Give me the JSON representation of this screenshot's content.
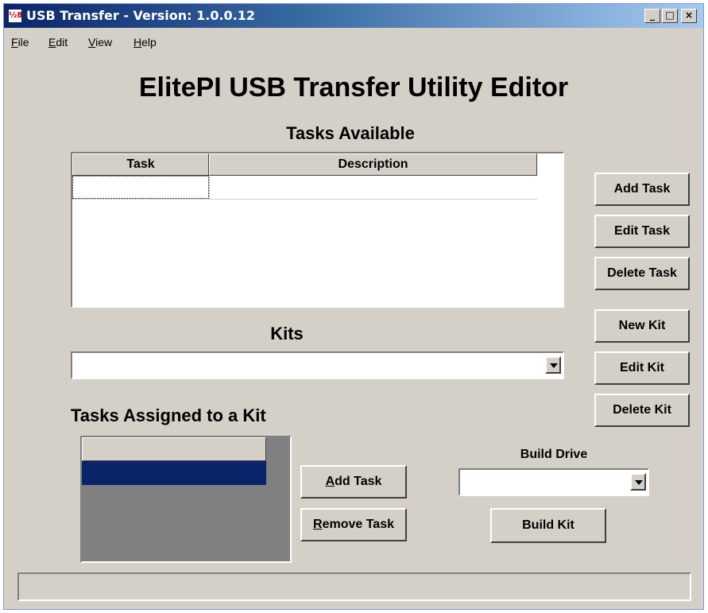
{
  "window": {
    "title": "USB Transfer - Version: 1.0.0.12",
    "app_icon": "½8",
    "controls": {
      "minimize": "_",
      "maximize": "□",
      "close": "×"
    }
  },
  "menu": [
    {
      "label_ul": "F",
      "label_rest": "ile"
    },
    {
      "label_ul": "E",
      "label_rest": "dit"
    },
    {
      "label_ul": "V",
      "label_rest": "iew"
    },
    {
      "label_ul": "H",
      "label_rest": "elp"
    }
  ],
  "main_title": "ElitePI USB Transfer Utility Editor",
  "tasks_available": {
    "heading": "Tasks Available",
    "columns": [
      "Task",
      "Description"
    ],
    "rows": [
      {
        "task": "",
        "description": ""
      }
    ]
  },
  "buttons": {
    "add_task": "Add Task",
    "edit_task": "Edit Task",
    "delete_task": "Delete Task",
    "new_kit": "New Kit",
    "edit_kit": "Edit Kit",
    "delete_kit": "Delete Kit",
    "assign_add_task_ul": "A",
    "assign_add_task_rest": "dd Task",
    "remove_task_ul": "R",
    "remove_task_rest": "emove Task",
    "build_kit": "Build Kit"
  },
  "kits": {
    "heading": "Kits",
    "selected": ""
  },
  "tasks_assigned": {
    "heading": "Tasks Assigned to a Kit"
  },
  "build_drive": {
    "label": "Build Drive",
    "selected": ""
  },
  "status_bar": {
    "text": ""
  },
  "colors": {
    "selection": "#0a246a",
    "face": "#d4d0c8",
    "list_empty": "#808080"
  }
}
